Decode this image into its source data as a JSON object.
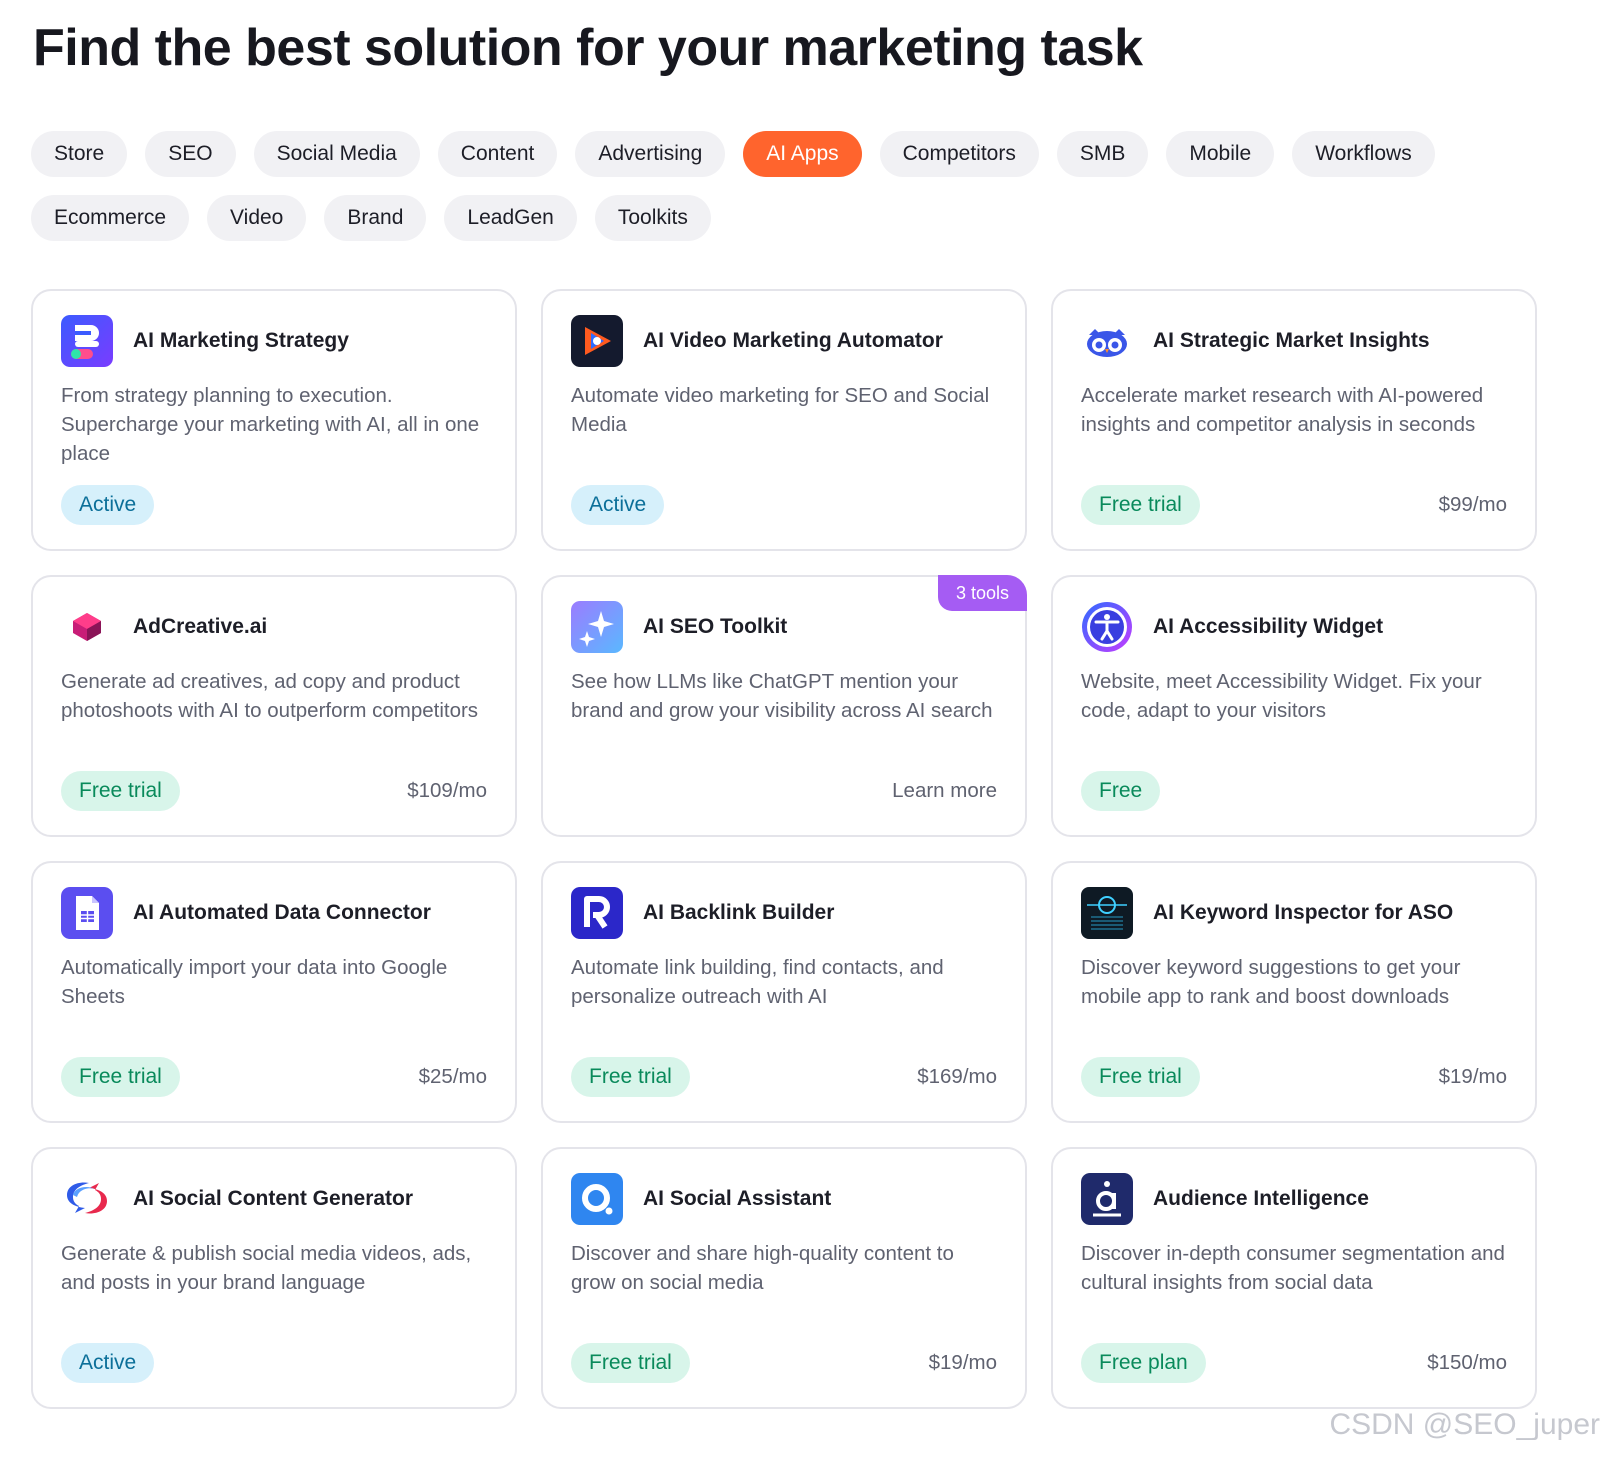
{
  "page": {
    "title": "Find the best solution for your marketing task"
  },
  "filters": {
    "row1": [
      "Store",
      "SEO",
      "Social Media",
      "Content",
      "Advertising",
      "AI Apps",
      "Competitors",
      "SMB",
      "Mobile",
      "Workflows"
    ],
    "row2": [
      "Ecommerce",
      "Video",
      "Brand",
      "LeadGen",
      "Toolkits"
    ],
    "active": "AI Apps"
  },
  "cards": [
    {
      "title": "AI Marketing Strategy",
      "desc": "From strategy planning to execution. Supercharge your marketing with AI, all in one place",
      "badge": "Active",
      "icon": "marketing-strategy-icon"
    },
    {
      "title": "AI Video Marketing Automator",
      "desc": "Automate video marketing for SEO and Social Media",
      "badge": "Active",
      "icon": "video-play-icon"
    },
    {
      "title": "AI Strategic Market Insights",
      "desc": "Accelerate market research with AI-powered insights and competitor analysis in seconds",
      "badge": "Free trial",
      "price": "$99/mo",
      "icon": "owl-icon"
    },
    {
      "title": "AdCreative.ai",
      "desc": "Generate ad creatives, ad copy and product photoshoots with AI to outperform competitors",
      "badge": "Free trial",
      "price": "$109/mo",
      "icon": "cube-icon"
    },
    {
      "title": "AI SEO Toolkit",
      "desc": "See how LLMs like ChatGPT mention your brand and grow your visibility across AI search",
      "link": "Learn more",
      "tag": "3 tools",
      "icon": "sparkle-icon"
    },
    {
      "title": "AI Accessibility Widget",
      "desc": "Website, meet Accessibility Widget. Fix your code, adapt to your visitors",
      "badge": "Free",
      "icon": "accessibility-icon"
    },
    {
      "title": "AI Automated Data Connector",
      "desc": "Automatically import your data into Google Sheets",
      "badge": "Free trial",
      "price": "$25/mo",
      "icon": "sheets-icon"
    },
    {
      "title": "AI Backlink Builder",
      "desc": "Automate link building, find contacts, and personalize outreach with AI",
      "badge": "Free trial",
      "price": "$169/mo",
      "icon": "letter-r-icon"
    },
    {
      "title": "AI Keyword Inspector for ASO",
      "desc": "Discover keyword suggestions to get your mobile app to rank and boost downloads",
      "badge": "Free trial",
      "price": "$19/mo",
      "icon": "scanner-icon"
    },
    {
      "title": "AI Social Content Generator",
      "desc": "Generate & publish social media videos, ads, and posts in your brand language",
      "badge": "Active",
      "icon": "chat-bubbles-icon"
    },
    {
      "title": "AI Social Assistant",
      "desc": "Discover and share high-quality content to grow on social media",
      "badge": "Free trial",
      "price": "$19/mo",
      "icon": "ring-icon"
    },
    {
      "title": "Audience Intelligence",
      "desc": "Discover in-depth consumer segmentation and cultural insights from social data",
      "badge": "Free plan",
      "price": "$150/mo",
      "icon": "letter-a-icon"
    }
  ],
  "watermark": "CSDN @SEO_juper"
}
